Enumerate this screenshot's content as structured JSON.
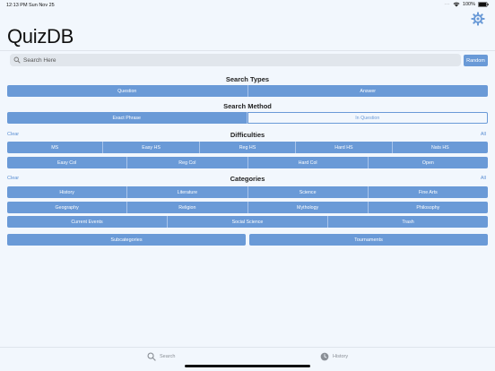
{
  "status_bar": {
    "time": "12:13 PM",
    "date": "Sun Nov 25",
    "battery": "100%",
    "dots": "···"
  },
  "app": {
    "title": "QuizDB",
    "accent_color": "#6a9ad7"
  },
  "search": {
    "placeholder": "Search Here",
    "value": "",
    "random_label": "Random"
  },
  "search_types": {
    "heading": "Search Types",
    "options": [
      "Question",
      "Answer"
    ]
  },
  "search_method": {
    "heading": "Search Method",
    "selected": "Exact Phrase",
    "options": [
      "Exact Phrase",
      "In Question"
    ]
  },
  "difficulties": {
    "heading": "Difficulties",
    "clear_label": "Clear",
    "all_label": "All",
    "row1": [
      "MS",
      "Easy HS",
      "Reg HS",
      "Hard HS",
      "Nats HS"
    ],
    "row2": [
      "Easy Col",
      "Reg Col",
      "Hard Col",
      "Open"
    ]
  },
  "categories": {
    "heading": "Categories",
    "clear_label": "Clear",
    "all_label": "All",
    "row1": [
      "History",
      "Literature",
      "Science",
      "Fine Arts"
    ],
    "row2": [
      "Geography",
      "Religion",
      "Mythology",
      "Philosophy"
    ],
    "row3": [
      "Current Events",
      "Social Science",
      "Trash"
    ]
  },
  "extra": {
    "subcategories_label": "Subcategories",
    "tournaments_label": "Tournaments"
  },
  "tab_bar": {
    "search_label": "Search",
    "history_label": "History"
  }
}
